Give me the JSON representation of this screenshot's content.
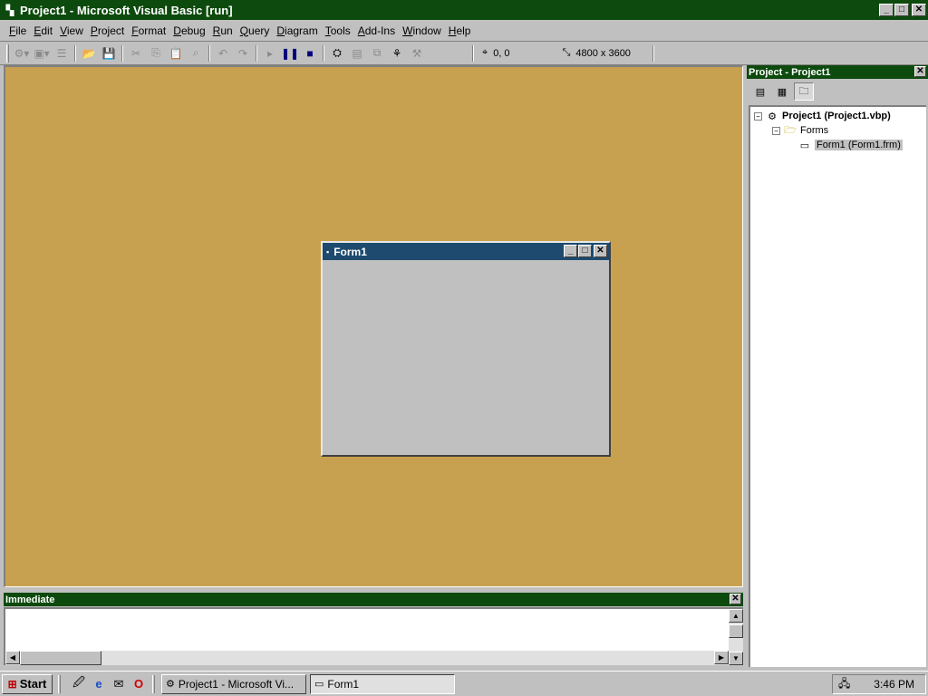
{
  "window": {
    "title": "Project1 - Microsoft Visual Basic [run]",
    "icon": "vb-icon"
  },
  "menu": [
    {
      "label": "File",
      "accel": "F",
      "rest": "ile"
    },
    {
      "label": "Edit",
      "accel": "E",
      "rest": "dit"
    },
    {
      "label": "View",
      "accel": "V",
      "rest": "iew"
    },
    {
      "label": "Project",
      "accel": "P",
      "rest": "roject"
    },
    {
      "label": "Format",
      "accel": "F",
      "rest": "ormat"
    },
    {
      "label": "Debug",
      "accel": "D",
      "rest": "ebug"
    },
    {
      "label": "Run",
      "accel": "R",
      "rest": "un"
    },
    {
      "label": "Query",
      "accel": "Q",
      "rest": "uery"
    },
    {
      "label": "Diagram",
      "accel": "D",
      "rest": "iagram"
    },
    {
      "label": "Tools",
      "accel": "T",
      "rest": "ools"
    },
    {
      "label": "Add-Ins",
      "accel": "A",
      "rest": "dd-Ins"
    },
    {
      "label": "Window",
      "accel": "W",
      "rest": "indow"
    },
    {
      "label": "Help",
      "accel": "H",
      "rest": "elp"
    }
  ],
  "toolbar": {
    "position": "0, 0",
    "size": "4800 x 3600"
  },
  "form1": {
    "title": "Form1"
  },
  "project_explorer": {
    "title": "Project - Project1",
    "tree": {
      "root": "Project1 (Project1.vbp)",
      "folder": "Forms",
      "item": "Form1 (Form1.frm)"
    }
  },
  "immediate": {
    "title": "Immediate"
  },
  "taskbar": {
    "start": "Start",
    "tasks": [
      {
        "label": "Project1 - Microsoft Vi...",
        "active": false
      },
      {
        "label": "Form1",
        "active": true
      }
    ],
    "clock": "3:46 PM"
  },
  "colors": {
    "title_active": "#0d4a0d",
    "form_title": "#1d4a6e",
    "designer_bg": "#c8a150",
    "face": "#c0c0c0"
  }
}
